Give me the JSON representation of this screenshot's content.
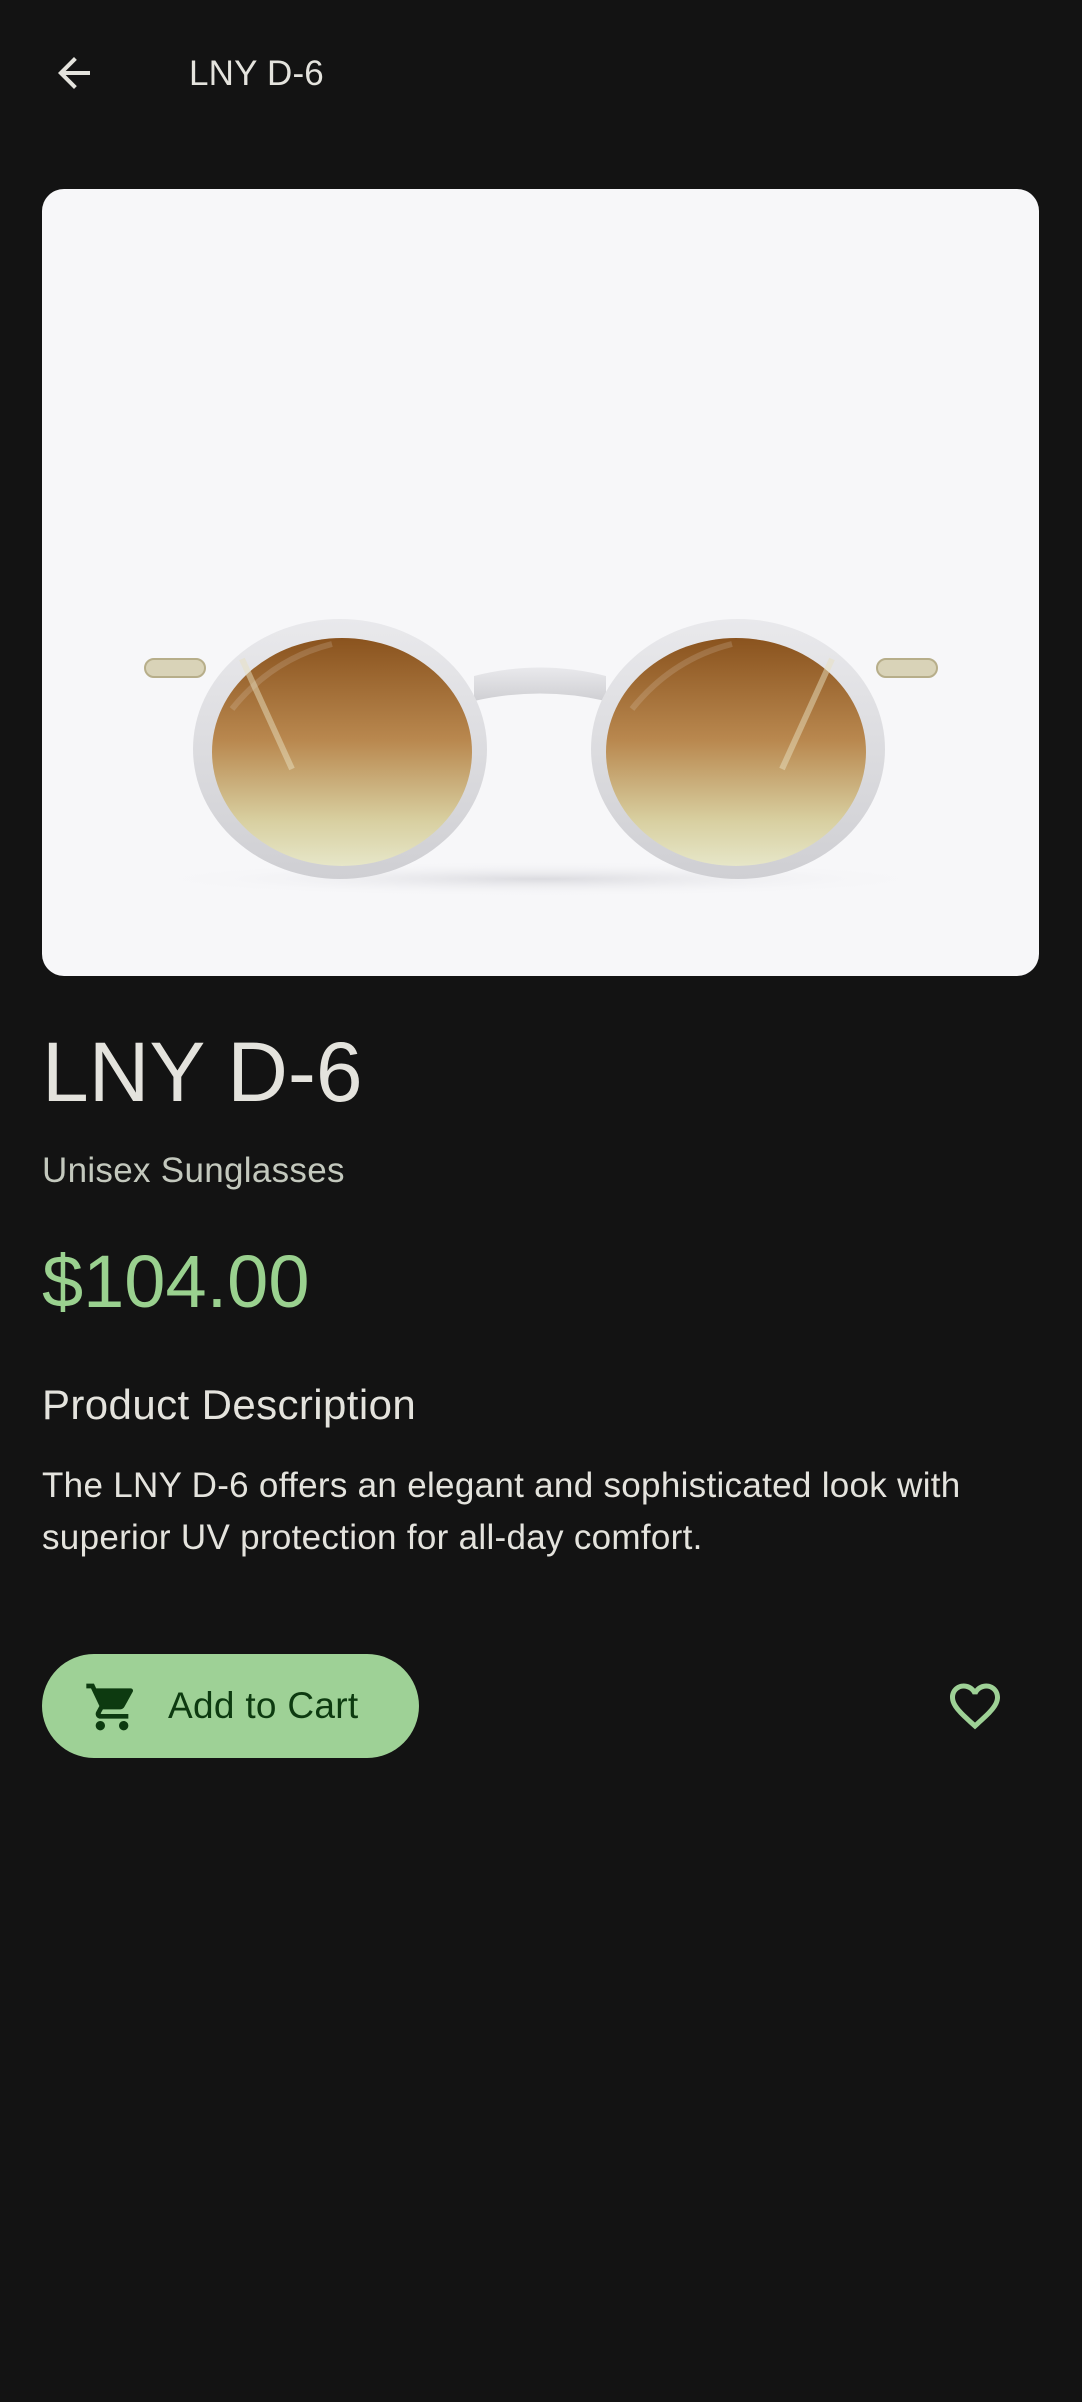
{
  "app_bar": {
    "title": "LNY D-6",
    "back_icon": "arrow-back-icon"
  },
  "product": {
    "image_alt": "sunglasses-image",
    "name": "LNY D-6",
    "category": "Unisex Sunglasses",
    "price": "$104.00",
    "description_title": "Product Description",
    "description": "The LNY D-6 offers an elegant and sophisticated look with superior UV protection for all-day comfort."
  },
  "actions": {
    "add_to_cart_label": "Add to Cart",
    "cart_icon": "shopping-cart-icon",
    "favorite_icon": "heart-outline-icon"
  },
  "colors": {
    "background": "#131313",
    "accent": "#9ed196",
    "price": "#9ad18f",
    "button_text": "#0d3a10"
  }
}
